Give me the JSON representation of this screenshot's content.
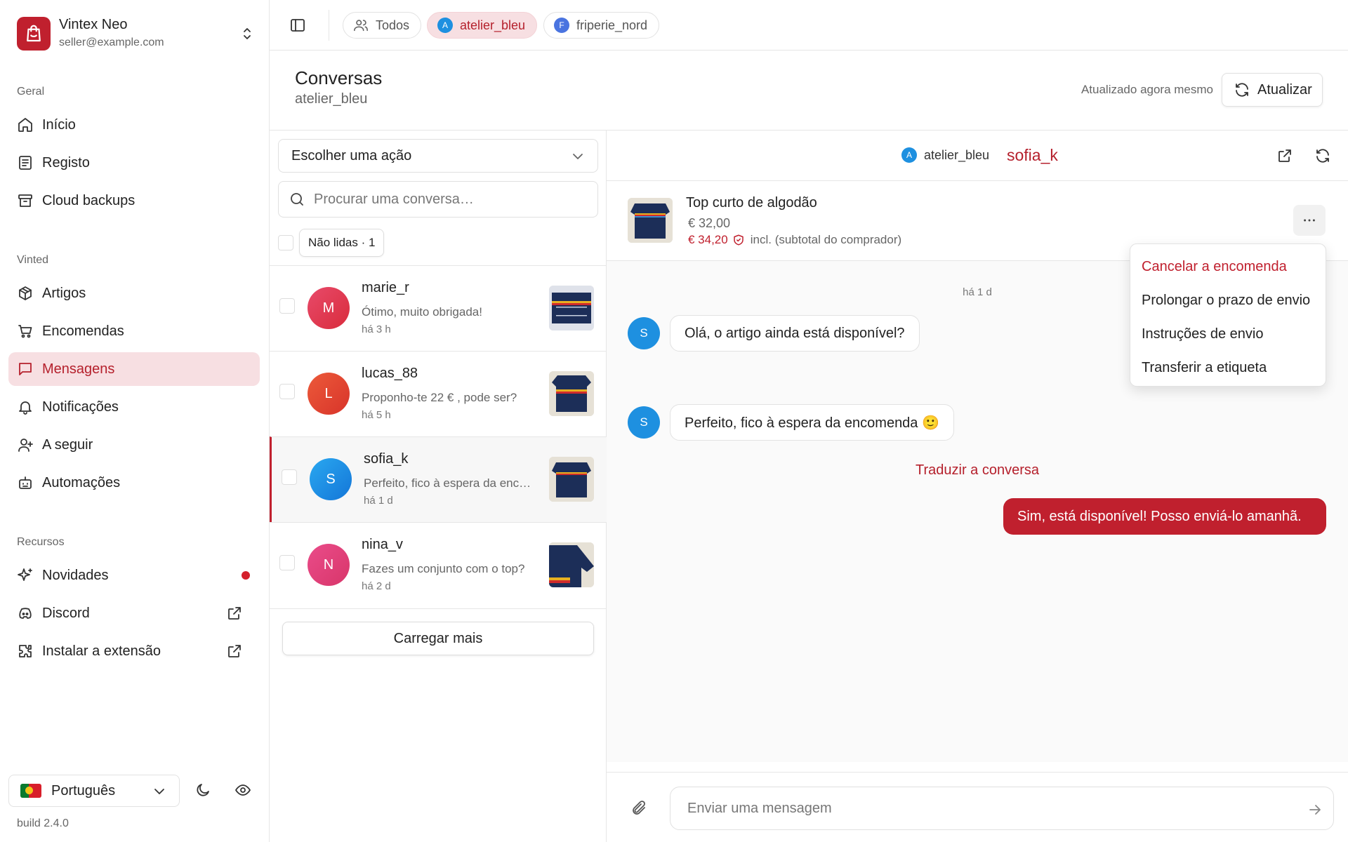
{
  "brand": {
    "name": "Vintex Neo",
    "email": "seller@example.com"
  },
  "sidebar": {
    "sections": [
      {
        "label": "Geral",
        "items": [
          {
            "label": "Início",
            "icon": "home-icon"
          },
          {
            "label": "Registo",
            "icon": "log-icon"
          },
          {
            "label": "Cloud backups",
            "icon": "archive-icon"
          }
        ]
      },
      {
        "label": "Vinted",
        "items": [
          {
            "label": "Artigos",
            "icon": "package-icon"
          },
          {
            "label": "Encomendas",
            "icon": "cart-icon"
          },
          {
            "label": "Mensagens",
            "icon": "message-icon",
            "active": true
          },
          {
            "label": "Notificações",
            "icon": "bell-icon"
          },
          {
            "label": "A seguir",
            "icon": "user-plus-icon"
          },
          {
            "label": "Automações",
            "icon": "bot-icon"
          }
        ]
      },
      {
        "label": "Recursos",
        "items": [
          {
            "label": "Novidades",
            "icon": "sparkles-icon",
            "badge": "dot"
          },
          {
            "label": "Discord",
            "icon": "discord-icon",
            "external": true
          },
          {
            "label": "Instalar a extensão",
            "icon": "puzzle-icon",
            "external": true
          }
        ]
      }
    ],
    "language": "Português",
    "build": "build 2.4.0"
  },
  "topbar": {
    "chips": [
      {
        "label": "Todos",
        "icon": "users-icon"
      },
      {
        "label": "atelier_bleu",
        "initial": "A",
        "active": true
      },
      {
        "label": "friperie_nord",
        "initial": "F"
      }
    ]
  },
  "page": {
    "title": "Conversas",
    "subtitle": "atelier_bleu",
    "updated": "Atualizado agora mesmo",
    "refresh_label": "Atualizar"
  },
  "list": {
    "action_placeholder": "Escolher uma ação",
    "search_placeholder": "Procurar uma conversa…",
    "unread_filter": "Não lidas · 1",
    "load_more": "Carregar mais",
    "conversations": [
      {
        "initial": "M",
        "name": "marie_r",
        "preview": "Ótimo, muito obrigada!",
        "time": "há 3 h"
      },
      {
        "initial": "L",
        "name": "lucas_88",
        "preview": "Proponho-te 22 € , pode ser?",
        "time": "há 5 h"
      },
      {
        "initial": "S",
        "name": "sofia_k",
        "preview": "Perfeito, fico à espera da encomenda 🙂",
        "time": "há 1 d",
        "active": true
      },
      {
        "initial": "N",
        "name": "nina_v",
        "preview": "Fazes um conjunto com o top?",
        "time": "há 2 d"
      }
    ]
  },
  "chat": {
    "account": "atelier_bleu",
    "account_initial": "A",
    "buyer": "sofia_k",
    "product": {
      "title": "Top curto de algodão",
      "price": "€ 32,00",
      "total": "€ 34,20",
      "total_note": "incl. (subtotal do comprador)"
    },
    "day_label": "há 1 d",
    "messages": [
      {
        "from": "buyer",
        "initial": "S",
        "text": "Olá, o artigo ainda está disponível?"
      },
      {
        "from": "me",
        "text": "Sim, está disponível! Posso enviá-lo amanhã."
      },
      {
        "from": "buyer",
        "initial": "S",
        "text": "Perfeito, fico à espera da encomenda 🙂"
      }
    ],
    "translate": "Traduzir a conversa",
    "input_placeholder": "Enviar uma mensagem"
  },
  "menu": {
    "items": [
      {
        "label": "Cancelar a encomenda",
        "danger": true
      },
      {
        "label": "Prolongar o prazo de envio"
      },
      {
        "label": "Instruções de envio"
      },
      {
        "label": "Transferir a etiqueta"
      }
    ]
  },
  "colors": {
    "accent": "#c0202e",
    "accent_soft": "#f7dfe2",
    "avatar_blue": "#1e90e0"
  }
}
